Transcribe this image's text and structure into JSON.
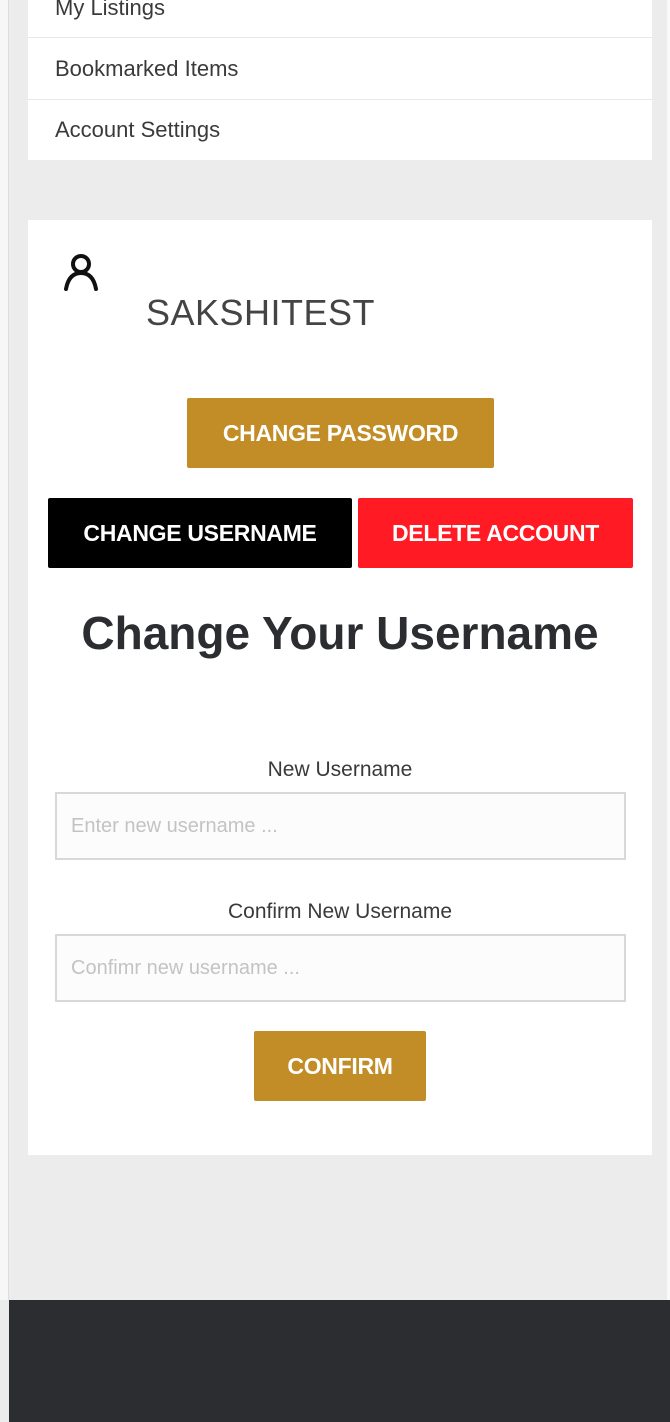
{
  "menu": {
    "items": [
      {
        "label": "My Listings"
      },
      {
        "label": "Bookmarked Items"
      },
      {
        "label": "Account Settings"
      }
    ]
  },
  "profile": {
    "icon": "user-icon",
    "username": "SAKSHITEST"
  },
  "actions": {
    "change_password": "CHANGE PASSWORD",
    "change_username": "CHANGE USERNAME",
    "delete_account": "DELETE ACCOUNT"
  },
  "form": {
    "heading": "Change Your Username",
    "new_username_label": "New Username",
    "new_username_placeholder": "Enter new username ...",
    "new_username_value": "",
    "confirm_username_label": "Confirm New Username",
    "confirm_username_placeholder": "Confimr new username ...",
    "confirm_username_value": "",
    "confirm_button": "CONFIRM"
  },
  "colors": {
    "gold": "#c28d27",
    "black": "#000000",
    "red": "#ff1a24",
    "footer": "#2b2d31",
    "background": "#ececec"
  }
}
